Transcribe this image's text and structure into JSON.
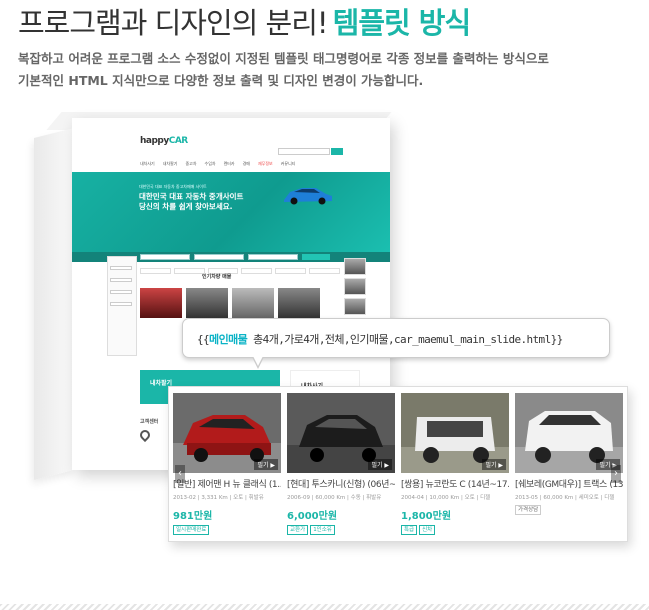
{
  "headline": {
    "main": "프로그램과 디자인의 분리!",
    "accent": "템플릿 방식"
  },
  "description": {
    "line1": "복잡하고 어려운 프로그램 소스 수정없이 지정된 템플릿 태그명령어로 각종 정보를 출력하는 방식으로",
    "line2": "기본적인 HTML 지식만으로 다양한 정보 출력 및 디자인 변경이 가능합니다."
  },
  "mock_site": {
    "logo_main": "happy",
    "logo_car": "CAR",
    "nav": [
      "내차사기",
      "내차팔기",
      "중고차",
      "수입차",
      "렌터카",
      "경매",
      "재무정보",
      "커뮤니티"
    ],
    "hero_subtitle": "대한민국 대표 자동차 중고차매매 사이트",
    "hero_title_line1": "대한민국 대표 자동차 중개사이트",
    "hero_title_line2": "당신의 차를 쉽게 찾아보세요.",
    "section_title": "인기차량 매물",
    "banner_sell": "내차팔기",
    "banner_buy": "내차사기",
    "footer_cs": "고객센터"
  },
  "template_tag": {
    "prefix": "{{",
    "highlight": "메인매물",
    "rest": " 총4개,가로4개,전체,인기매물,car_maemul_main_slide.html}}"
  },
  "listings": [
    {
      "title": "[일반] 제어맨 H 뉴 클래식 (1...",
      "meta": "2013-02 | 3,331 Km | 오토 | 휘발유",
      "price": "981만원",
      "tags": [
        "일시판매완료"
      ],
      "badge": "필기 ▶",
      "car_color": "#b21b1b"
    },
    {
      "title": "[현대] 투스카니(신형) (06년~...",
      "meta": "2006-09 | 60,000 Km | 수동 | 휘발유",
      "price": "6,000만원",
      "tags": [
        "교환가",
        "1인소유"
      ],
      "badge": "필기 ▶",
      "car_color": "#1c1c1c"
    },
    {
      "title": "[쌍용] 뉴코란도 C (14년~17...",
      "meta": "2004-04 | 10,000 Km | 오토 | 디젤",
      "price": "1,800만원",
      "tags": [
        "특급",
        "신차"
      ],
      "badge": "필기 ▶",
      "car_color": "#e8e8e8"
    },
    {
      "title": "[쉐보레(GM대우)] 트랙스 (13...",
      "meta": "2013-05 | 60,000 Km | 세미오토 | 디젤",
      "price": "",
      "tags": [
        "가격상담"
      ],
      "badge": "필기 ▶",
      "car_color": "#f2f2f2"
    }
  ]
}
